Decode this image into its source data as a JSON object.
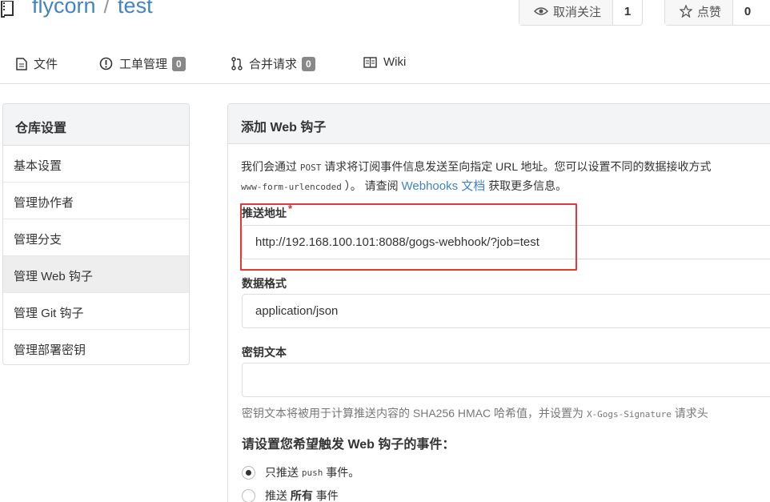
{
  "repo": {
    "owner": "flycorn",
    "separator": "/",
    "name": "test"
  },
  "actions": {
    "watch": {
      "label": "取消关注",
      "count": "1",
      "icon": "eye-icon"
    },
    "star": {
      "label": "点赞",
      "count": "0",
      "icon": "star-icon"
    }
  },
  "tabs": [
    {
      "label": "文件",
      "icon": "file-icon"
    },
    {
      "label": "工单管理",
      "badge": "0",
      "icon": "issue-icon"
    },
    {
      "label": "合并请求",
      "badge": "0",
      "icon": "pull-request-icon"
    },
    {
      "label": "Wiki",
      "icon": "book-icon"
    }
  ],
  "sidebar": {
    "title": "仓库设置",
    "items": [
      {
        "label": "基本设置"
      },
      {
        "label": "管理协作者"
      },
      {
        "label": "管理分支"
      },
      {
        "label": "管理 Web 钩子",
        "active": true
      },
      {
        "label": "管理 Git 钩子"
      },
      {
        "label": "管理部署密钥"
      }
    ]
  },
  "form": {
    "title": "添加 Web 钩子",
    "desc_line1_a": "我们会通过",
    "desc_line1_code": "POST",
    "desc_line1_b": "请求将订阅事件信息发送至向指定 URL 地址。您可以设置不同的数据接收方式",
    "desc_line2_code": "www-form-urlencoded",
    "desc_line2_a": "）。 请查阅",
    "desc_link": "Webhooks 文档",
    "desc_line2_b": "获取更多信息。",
    "payload_url_label": "推送地址",
    "required_mark": "*",
    "payload_url_value": "http://192.168.100.101:8088/gogs-webhook/?job=test",
    "content_type_label": "数据格式",
    "content_type_value": "application/json",
    "secret_label": "密钥文本",
    "secret_value": "",
    "secret_help_a": "密钥文本将被用于计算推送内容的 SHA256 HMAC 哈希值，并设置为",
    "secret_help_code": "X-Gogs-Signature",
    "secret_help_b": "请求头",
    "events_title": "请设置您希望触发 Web 钩子的事件：",
    "events": [
      {
        "prefix": "只推送",
        "code": "push",
        "suffix": "事件。",
        "checked": true
      },
      {
        "prefix": "推送",
        "bold": "所有",
        "suffix": "事件",
        "checked": false
      }
    ]
  }
}
